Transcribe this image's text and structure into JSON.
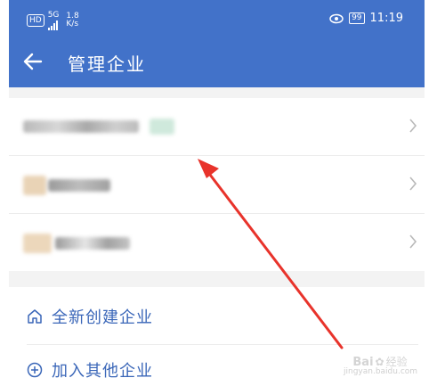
{
  "status_bar": {
    "hd": "HD",
    "network": "5G",
    "speed_value": "1.8",
    "speed_unit": "K/s",
    "battery": "99",
    "time": "11:19"
  },
  "header": {
    "title": "管理企业",
    "back_icon": "arrow-left-icon"
  },
  "companies": [
    {
      "name_visible": false
    },
    {
      "name_visible": false
    },
    {
      "name_visible": false
    }
  ],
  "actions": {
    "create_label": "全新创建企业",
    "join_label": "加入其他企业"
  },
  "watermark": {
    "brand": "Bai",
    "brand_suffix": "经验",
    "url": "jingyan.baidu.com"
  },
  "colors": {
    "header": "#4272c9",
    "action_text": "#3a66b8",
    "annotation_arrow": "#e8332b"
  }
}
